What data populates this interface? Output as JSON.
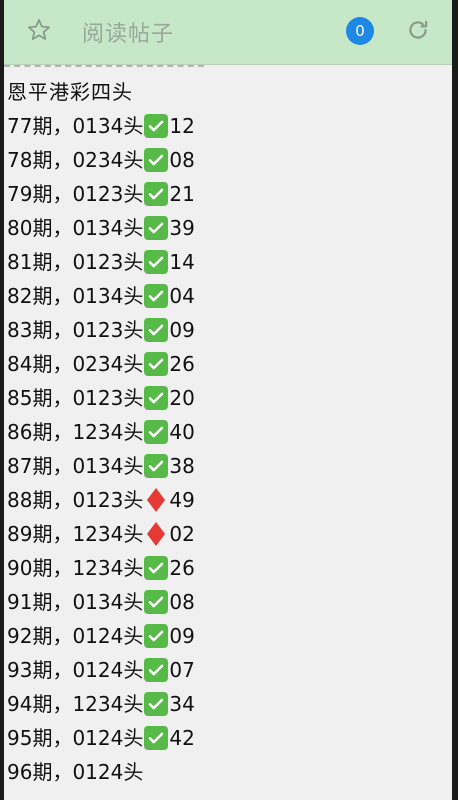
{
  "topbar": {
    "title": "阅读帖子",
    "badge": "0",
    "star_icon": "star-outline-icon",
    "refresh_icon": "refresh-icon"
  },
  "post": {
    "heading": "恩平港彩四头",
    "rows": [
      {
        "period": "77期，",
        "group": "0134头",
        "mark": "check",
        "number": "12"
      },
      {
        "period": "78期，",
        "group": "0234头",
        "mark": "check",
        "number": "08"
      },
      {
        "period": "79期，",
        "group": "0123头",
        "mark": "check",
        "number": "21"
      },
      {
        "period": "80期，",
        "group": "0134头",
        "mark": "check",
        "number": "39"
      },
      {
        "period": "81期，",
        "group": "0123头",
        "mark": "check",
        "number": "14"
      },
      {
        "period": "82期，",
        "group": "0134头",
        "mark": "check",
        "number": "04"
      },
      {
        "period": "83期，",
        "group": "0123头",
        "mark": "check",
        "number": "09"
      },
      {
        "period": "84期，",
        "group": "0234头",
        "mark": "check",
        "number": "26"
      },
      {
        "period": "85期，",
        "group": "0123头",
        "mark": "check",
        "number": "20"
      },
      {
        "period": "86期，",
        "group": "1234头",
        "mark": "check",
        "number": "40"
      },
      {
        "period": "87期，",
        "group": "0134头",
        "mark": "check",
        "number": "38"
      },
      {
        "period": "88期，",
        "group": "0123头",
        "mark": "diamond",
        "number": "49"
      },
      {
        "period": "89期，",
        "group": "1234头",
        "mark": "diamond",
        "number": "02"
      },
      {
        "period": "90期，",
        "group": "1234头",
        "mark": "check",
        "number": "26"
      },
      {
        "period": "91期，",
        "group": "0134头",
        "mark": "check",
        "number": "08"
      },
      {
        "period": "92期，",
        "group": "0124头",
        "mark": "check",
        "number": "09"
      },
      {
        "period": "93期，",
        "group": "0124头",
        "mark": "check",
        "number": "07"
      },
      {
        "period": "94期，",
        "group": "1234头",
        "mark": "check",
        "number": "34"
      },
      {
        "period": "95期，",
        "group": "0124头",
        "mark": "check",
        "number": "42"
      },
      {
        "period": "96期，",
        "group": "0124头",
        "mark": "none",
        "number": ""
      }
    ]
  },
  "colors": {
    "topbar_bg": "#c6e8c8",
    "badge_bg": "#1e88e5",
    "check_bg": "#57b947",
    "diamond": "#e53935"
  }
}
